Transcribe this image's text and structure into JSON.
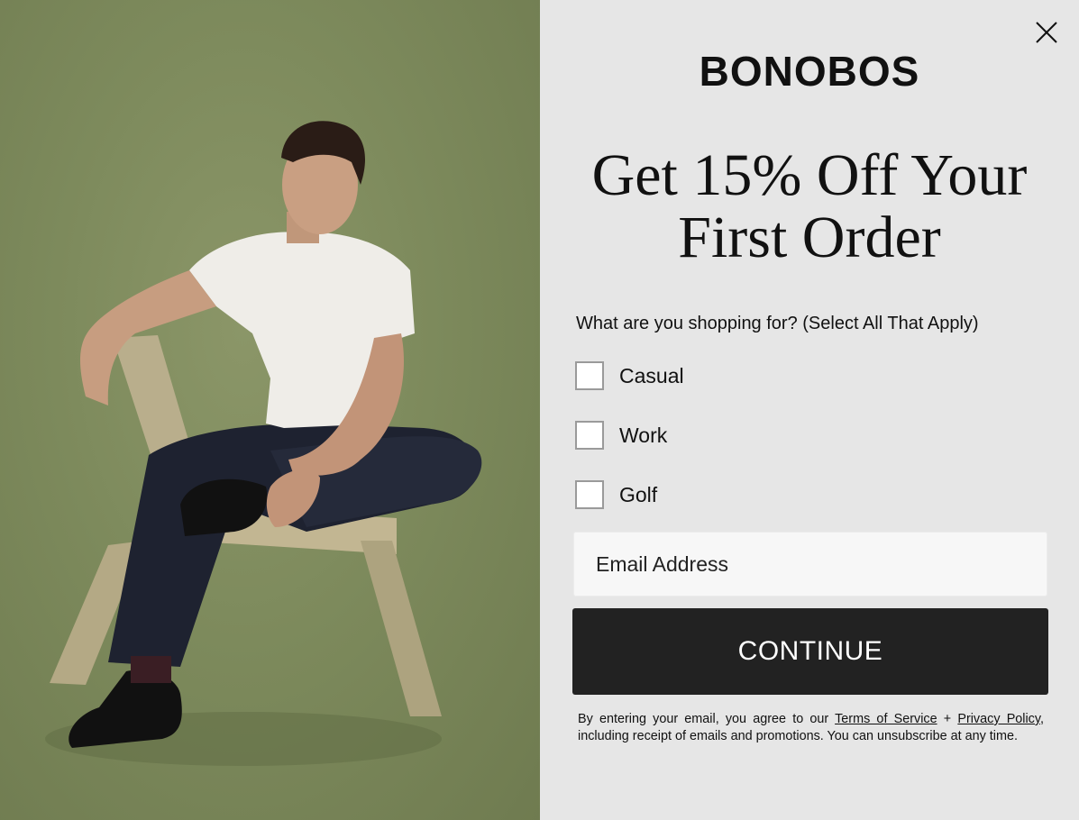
{
  "brand": {
    "logo_text": "BONOBOS"
  },
  "promo": {
    "headline_line1": "Get 15% Off Your",
    "headline_line2": "First Order"
  },
  "form": {
    "question": "What are you shopping for? (Select All That Apply)",
    "options": [
      {
        "label": "Casual",
        "checked": false
      },
      {
        "label": "Work",
        "checked": false
      },
      {
        "label": "Golf",
        "checked": false
      }
    ],
    "email_placeholder": "Email Address",
    "continue_label": "CONTINUE"
  },
  "disclaimer": {
    "prefix": "By entering your email, you agree to our ",
    "terms_link": "Terms of Service",
    "joiner": " + ",
    "privacy_link": "Privacy Policy",
    "suffix": ", including receipt of emails and promotions. You can unsubscribe at any time."
  },
  "icons": {
    "close": "close-icon"
  },
  "colors": {
    "panel_background": "#e6e6e6",
    "photo_background": "#7d8a5c",
    "button_background": "#222222",
    "button_text": "#ffffff"
  }
}
